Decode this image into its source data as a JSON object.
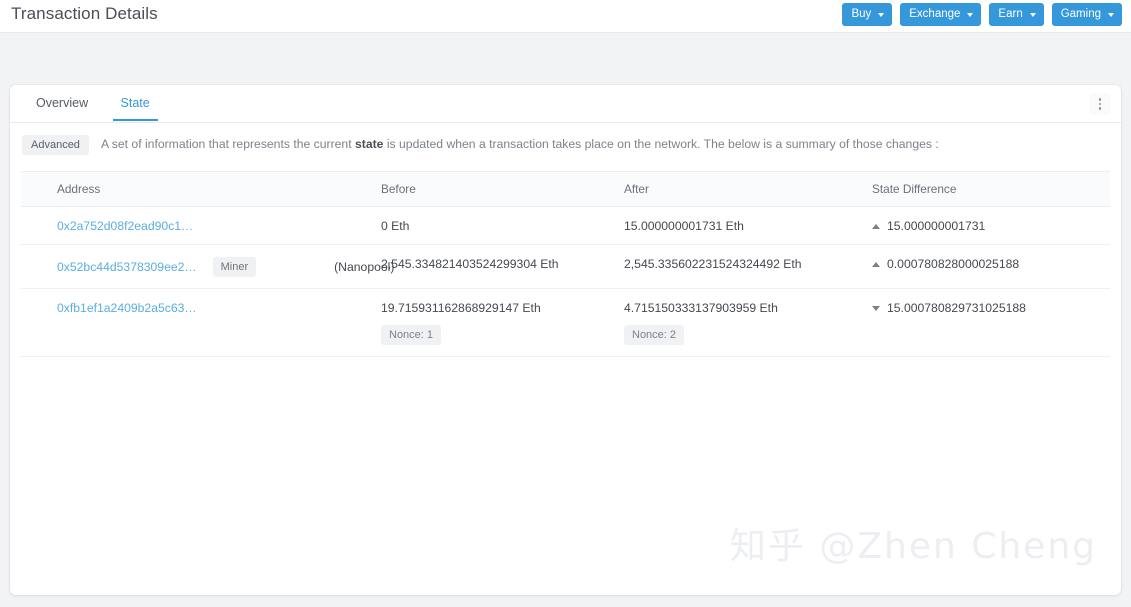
{
  "header": {
    "title": "Transaction Details",
    "buttons": [
      {
        "label": "Buy",
        "icon": "chevron-down-icon"
      },
      {
        "label": "Exchange",
        "icon": "chevron-down-icon"
      },
      {
        "label": "Earn",
        "icon": "chevron-down-icon"
      },
      {
        "label": "Gaming",
        "icon": "chevron-down-icon"
      }
    ],
    "accent_color": "#3498db"
  },
  "card": {
    "tabs": [
      {
        "label": "Overview",
        "active": false
      },
      {
        "label": "State",
        "active": true
      }
    ],
    "menu_icon": "kebab-menu-icon",
    "note": {
      "badge": "Advanced",
      "text_before": "A set of information that represents the current ",
      "text_bold": "state",
      "text_after": " is updated when a transaction takes place on the network. The below is a summary of those changes :"
    },
    "table": {
      "columns": [
        "Address",
        "Before",
        "After",
        "State Difference"
      ],
      "rows": [
        {
          "address": "0x2a752d08f2ead90c1…",
          "tag": "",
          "pool": "",
          "before": "0 Eth",
          "before_nonce": "",
          "after": "15.000000001731 Eth",
          "after_nonce": "",
          "diff_direction": "up",
          "diff": "15.000000001731"
        },
        {
          "address": "0x52bc44d5378309ee2…",
          "tag": "Miner",
          "pool": "(Nanopool)",
          "before": "2,545.334821403524299304 Eth",
          "before_nonce": "",
          "after": "2,545.335602231524324492 Eth",
          "after_nonce": "",
          "diff_direction": "up",
          "diff": "0.000780828000025188"
        },
        {
          "address": "0xfb1ef1a2409b2a5c63…",
          "tag": "",
          "pool": "",
          "before": "19.715931162868929147 Eth",
          "before_nonce": "Nonce: 1",
          "after": "4.715150333137903959 Eth",
          "after_nonce": "Nonce: 2",
          "diff_direction": "down",
          "diff": "15.000780829731025188"
        }
      ]
    }
  },
  "watermark": "知乎 @Zhen Cheng"
}
